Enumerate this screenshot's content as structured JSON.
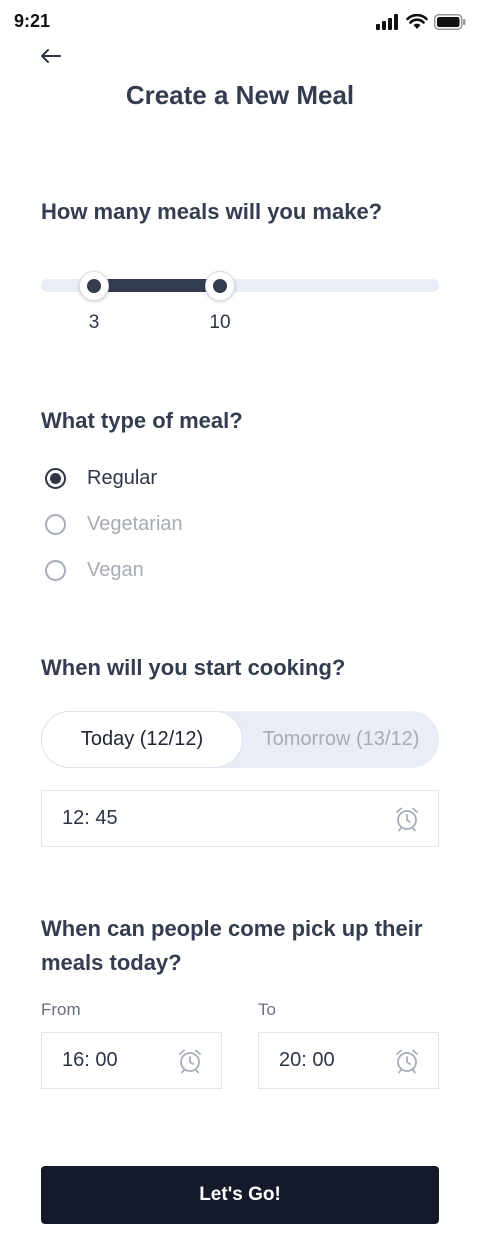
{
  "status_bar": {
    "time": "9:21",
    "icons": [
      "signal-icon",
      "wifi-icon",
      "battery-icon"
    ]
  },
  "header": {
    "back_icon": "arrow-left-icon",
    "title": "Create a New Meal"
  },
  "meal_count": {
    "question": "How many meals will you make?",
    "min_value": "3",
    "max_value": "10"
  },
  "meal_type": {
    "question": "What type of meal?",
    "options": [
      {
        "label": "Regular",
        "selected": true
      },
      {
        "label": "Vegetarian",
        "selected": false
      },
      {
        "label": "Vegan",
        "selected": false
      }
    ]
  },
  "cooking_start": {
    "question": "When will you start cooking?",
    "days": [
      {
        "label": "Today (12/12)",
        "selected": true
      },
      {
        "label": "Tomorrow (13/12)",
        "selected": false
      }
    ],
    "time": "12: 45",
    "time_icon": "alarm-clock-icon"
  },
  "pickup": {
    "question": "When can people come pick up their meals today?",
    "from_label": "From",
    "from_time": "16: 00",
    "to_label": "To",
    "to_time": "20: 00"
  },
  "submit": {
    "label": "Let's Go!"
  },
  "colors": {
    "primary": "#343c4f",
    "button": "#141a2a",
    "track": "#e9edf5",
    "muted_text": "#a7abb3"
  }
}
